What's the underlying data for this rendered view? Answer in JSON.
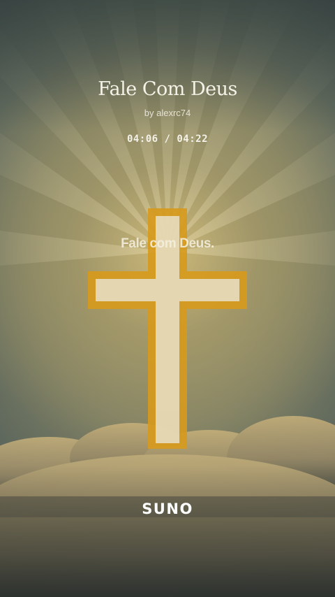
{
  "song": {
    "title": "Fale Com Deus",
    "artist_line": "by alexrc74",
    "time_display": "04:06 / 04:22"
  },
  "lyrics": {
    "current_line": "Fale com Deus."
  },
  "brand": {
    "logo_text": "SUNO"
  },
  "colors": {
    "cross_outline": "#d79a1c",
    "cross_fill": "#e7e3cf",
    "text": "#f4f1e6"
  }
}
